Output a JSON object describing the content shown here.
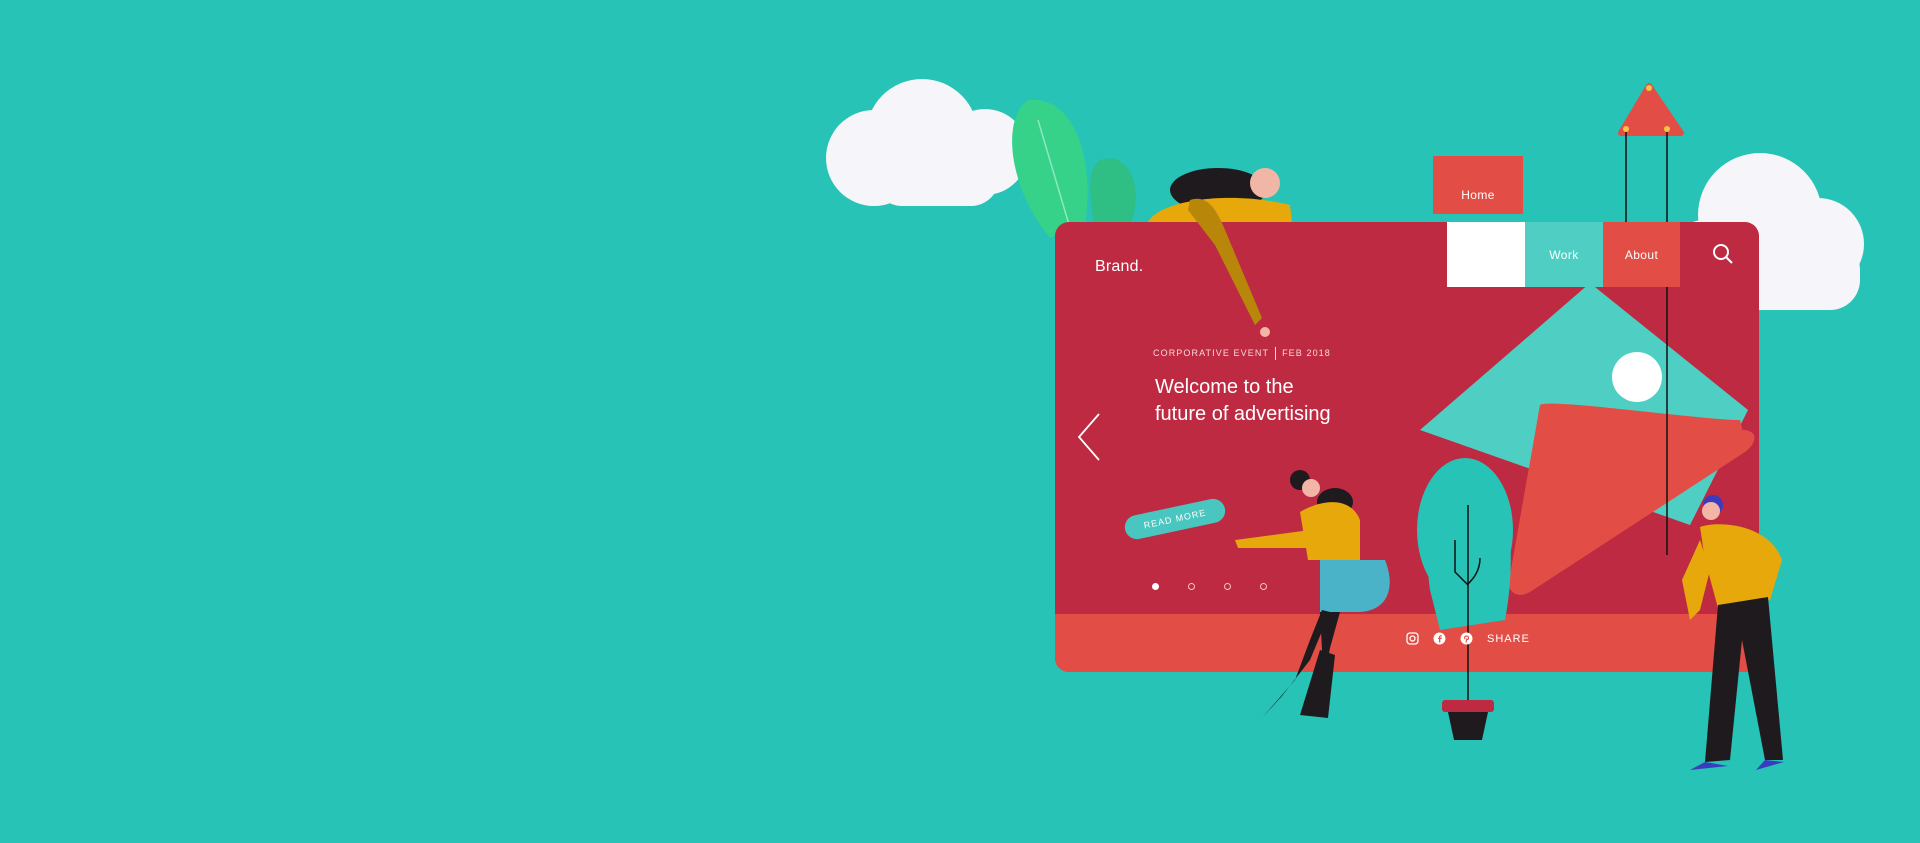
{
  "brand": "Brand.",
  "nav": {
    "home": "Home",
    "work": "Work",
    "about": "About"
  },
  "hero": {
    "eyebrow_left": "CORPORATIVE EVENT",
    "eyebrow_right": "FEB 2018",
    "headline_line1": "Welcome to the",
    "headline_line2": "future of advertising",
    "cta": "READ MORE"
  },
  "slider": {
    "total_slides": 4,
    "active_index": 0
  },
  "share": {
    "label": "SHARE",
    "icons": [
      "instagram-icon",
      "facebook-icon",
      "pinterest-icon"
    ]
  },
  "colors": {
    "background": "#27c3b6",
    "card": "#be2a41",
    "accent_red": "#e24e45",
    "accent_teal": "#4fcfc3",
    "figure_yellow": "#e6a80a"
  }
}
